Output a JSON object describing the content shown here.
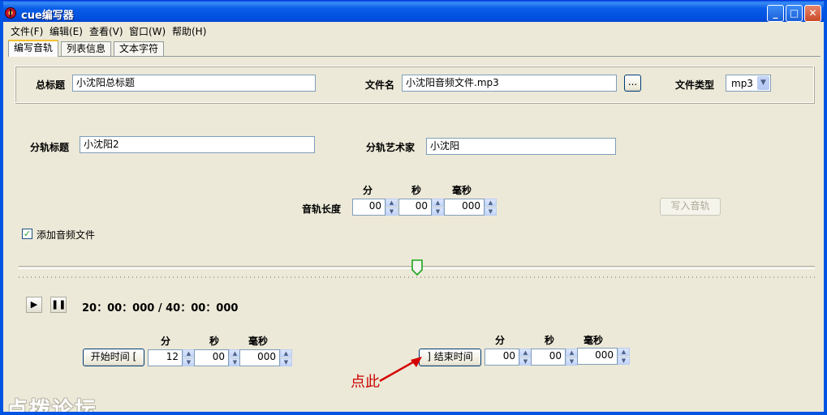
{
  "window": {
    "title": "cue编写器"
  },
  "menu": [
    "文件(F)",
    "编辑(E)",
    "查看(V)",
    "窗口(W)",
    "帮助(H)"
  ],
  "tabs": [
    "编写音轨",
    "列表信息",
    "文本字符"
  ],
  "header": {
    "title_label": "总标题",
    "title_value": "小沈阳总标题",
    "file_label": "文件名",
    "file_value": "小沈阳音频文件.mp3",
    "browse_label": "...",
    "type_label": "文件类型",
    "type_value": "mp3"
  },
  "track": {
    "title_label": "分轨标题",
    "title_value": "小沈阳2",
    "artist_label": "分轨艺术家",
    "artist_value": "小沈阳",
    "length_label": "音轨长度",
    "units": {
      "min": "分",
      "sec": "秒",
      "ms": "毫秒"
    },
    "length_min": "00",
    "length_sec": "00",
    "length_ms": "000",
    "write_button": "写入音轨"
  },
  "add_audio": {
    "label": "添加音频文件",
    "checked": true
  },
  "player": {
    "play_icon": "play-icon",
    "pause_icon": "pause-icon",
    "position_fraction": 0.5,
    "timecode": "20：00：000 / 40：00：000"
  },
  "start": {
    "button": "开始时间 [",
    "min": "12",
    "sec": "00",
    "ms": "000"
  },
  "end": {
    "button": "] 结束时间",
    "min": "00",
    "sec": "00",
    "ms": "000"
  },
  "annotation": "点此",
  "watermark": "点拨论坛",
  "colors": {
    "annotation": "#cc0000",
    "titlebar": "#0054e3",
    "face": "#ece9d8"
  }
}
